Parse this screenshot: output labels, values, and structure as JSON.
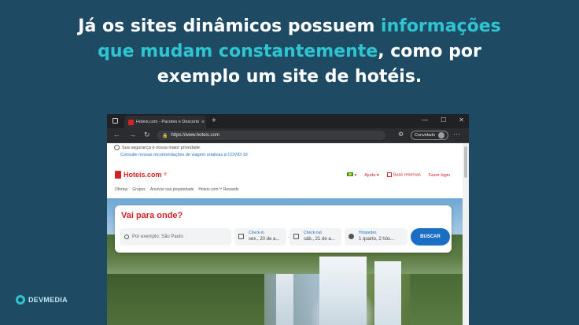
{
  "heading": {
    "line1_part1": "Já os sites dinâmicos possuem ",
    "line1_highlight": "informações",
    "line2_highlight": "que mudam constantemente",
    "line2_part2": ", como por",
    "line3": "exemplo um site de hotéis."
  },
  "logo": {
    "text": "DEVMEDIA"
  },
  "browser": {
    "tab_title": "Hoteis.com - Pacotes e Descontos",
    "tab_close": "×",
    "new_tab": "+",
    "window_controls": [
      "—",
      "☐",
      "✕"
    ],
    "url": "https://www.hoteis.com",
    "guest_label": "Convidado",
    "more": "···"
  },
  "page": {
    "notice_line1": "Sua segurança é nossa maior prioridade",
    "notice_line2": "Consulte nossas recomendações de viagem relativas à COVID-19",
    "brand": "Hoteis.com",
    "brand_sup": "®",
    "nav": {
      "help": "Ajuda",
      "reservations": "Suas reservas",
      "login": "Fazer login"
    },
    "subnav": [
      "Ofertas",
      "Grupos",
      "Anuncie sua propriedade",
      "Hoteis.com™ Rewards"
    ],
    "search": {
      "title": "Vai para onde?",
      "destination_placeholder": "Por exemplo: São Paulo",
      "checkin_label": "Check-in",
      "checkin_value": "sex., 20 de a...",
      "checkout_label": "Check-out",
      "checkout_value": "sáb., 21 de a...",
      "guests_label": "Hóspedes",
      "guests_value": "1 quarto, 2 hós...",
      "button": "BUSCAR"
    }
  }
}
